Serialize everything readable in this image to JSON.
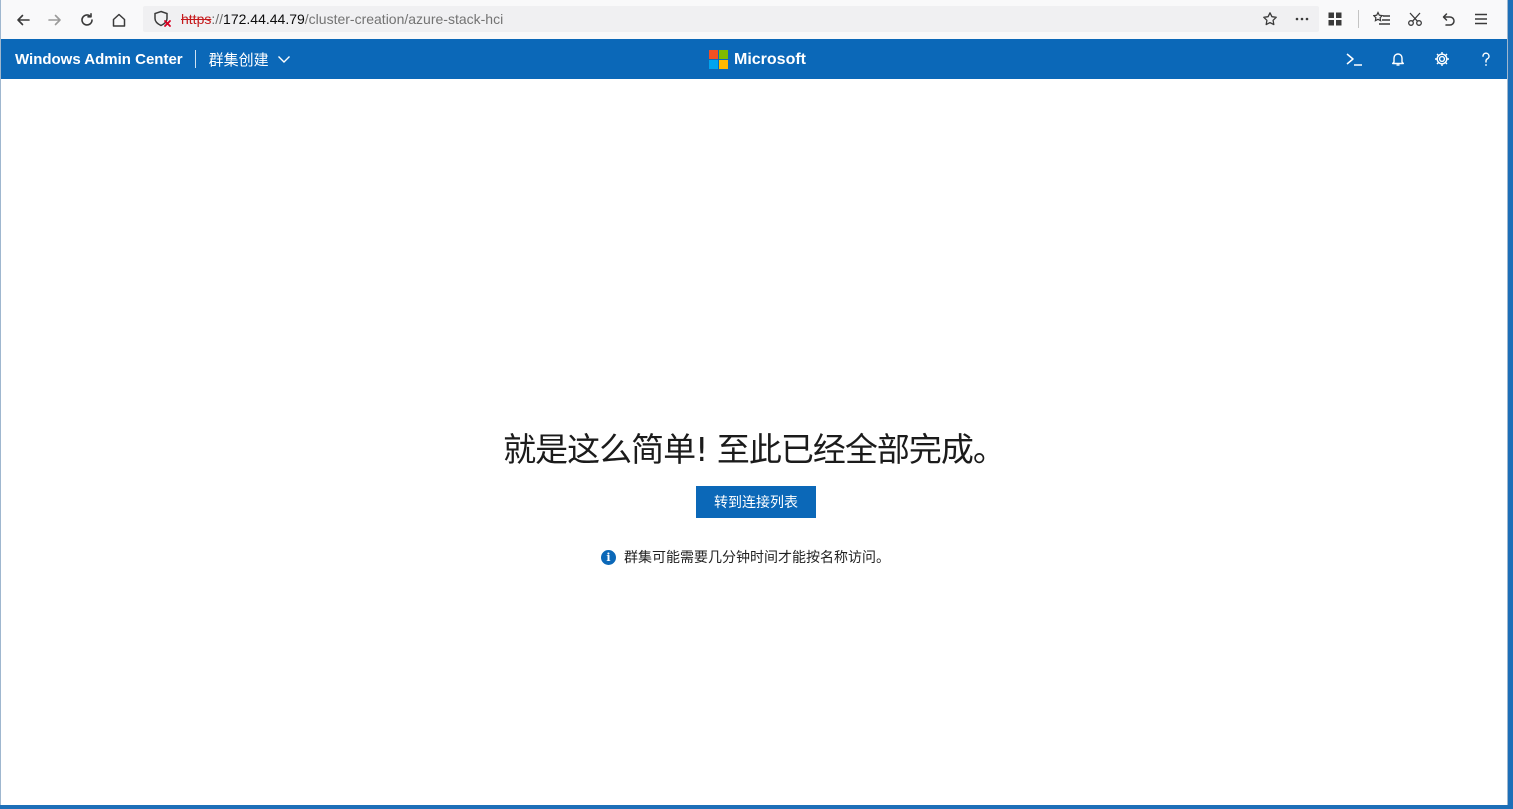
{
  "browser": {
    "url": {
      "scheme": "https",
      "separator": "://",
      "host": "172.44.44.79",
      "path": "/cluster-creation/azure-stack-hci"
    },
    "icons": {
      "back": "back-arrow-icon",
      "forward": "forward-arrow-icon",
      "reload": "reload-icon",
      "home": "home-icon",
      "security": "insecure-shield-icon",
      "bookmark": "star-icon",
      "page_actions": "more-dots-icon",
      "library": "apps-grid-icon",
      "favorites": "favorites-list-icon",
      "screenshot": "scissors-icon",
      "undo": "undo-icon",
      "menu": "hamburger-menu-icon"
    }
  },
  "header": {
    "app_title": "Windows Admin Center",
    "breadcrumb": "群集创建",
    "brand": "Microsoft",
    "brand_colors": [
      "#f25022",
      "#7fba00",
      "#00a4ef",
      "#ffb900"
    ],
    "icons": [
      "powershell-icon",
      "bell-icon",
      "gear-icon",
      "help-icon"
    ]
  },
  "main": {
    "headline": "就是这么简单! 至此已经全部完成。",
    "primary_button": "转到连接列表",
    "info_text": "群集可能需要几分钟时间才能按名称访问。",
    "info_icon_glyph": "i"
  },
  "colors": {
    "accent": "#0b68b8"
  }
}
